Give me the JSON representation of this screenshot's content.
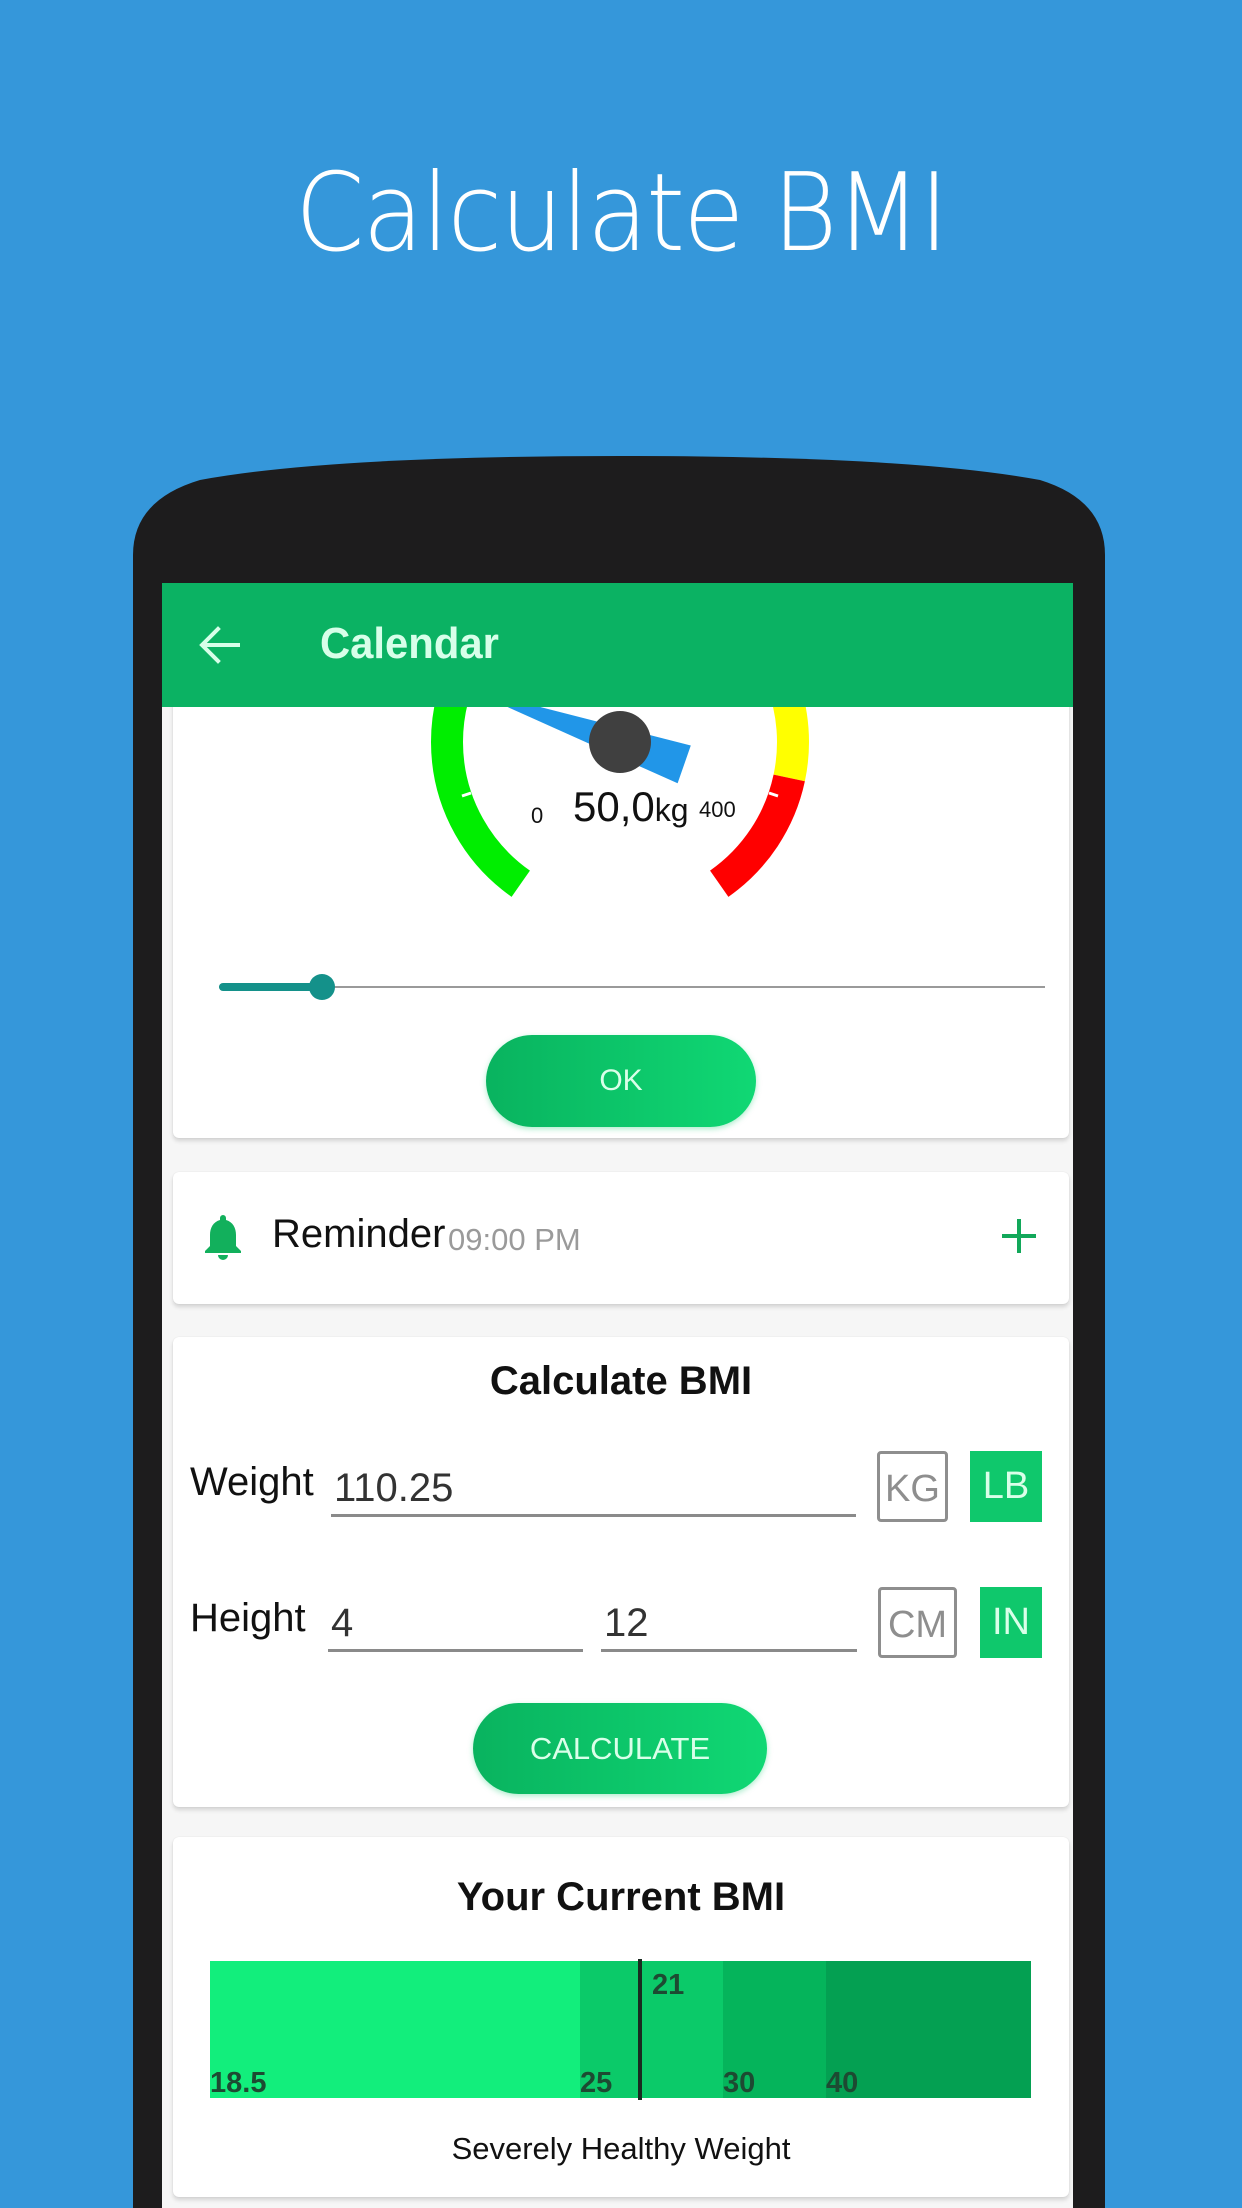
{
  "promo": {
    "title": "Calculate BMI"
  },
  "colors": {
    "background": "#3597da",
    "phone": "#1d1c1d",
    "header": "#0bb263",
    "accent": "#0fc86c",
    "slider": "#14918a",
    "needle": "#2196e8",
    "gauge_low": "#00ee00",
    "gauge_mid": "#ffff00",
    "gauge_high": "#ff0000"
  },
  "header": {
    "title": "Calendar",
    "back_icon": "arrow-left-icon"
  },
  "weight_gauge": {
    "min_label": "0",
    "max_label": "400",
    "min": 0,
    "max": 400,
    "value": 50.0,
    "value_label": "50,0",
    "unit_label": "kg",
    "slider_fraction": 0.125,
    "ok_label": "OK"
  },
  "reminder": {
    "icon": "bell-icon",
    "label": "Reminder",
    "time": "09:00 PM",
    "add_icon": "plus-icon"
  },
  "calculator": {
    "title": "Calculate BMI",
    "weight_label": "Weight",
    "weight_value": "110.25",
    "weight_units": [
      {
        "label": "KG",
        "selected": false
      },
      {
        "label": "LB",
        "selected": true
      }
    ],
    "height_label": "Height",
    "height_value_1": "4",
    "height_value_2": "12",
    "height_units": [
      {
        "label": "CM",
        "selected": false
      },
      {
        "label": "IN",
        "selected": true
      }
    ],
    "calculate_label": "CALCULATE"
  },
  "bmi_result": {
    "title": "Your Current BMI",
    "value": 21,
    "value_label": "21",
    "status": "Severely Healthy Weight",
    "scale": [
      {
        "label": "18.5",
        "color": "#12ee7c"
      },
      {
        "label": "25",
        "color": "#0bca69"
      },
      {
        "label": "30",
        "color": "#05b45b"
      },
      {
        "label": "40",
        "color": "#04a052"
      }
    ]
  }
}
